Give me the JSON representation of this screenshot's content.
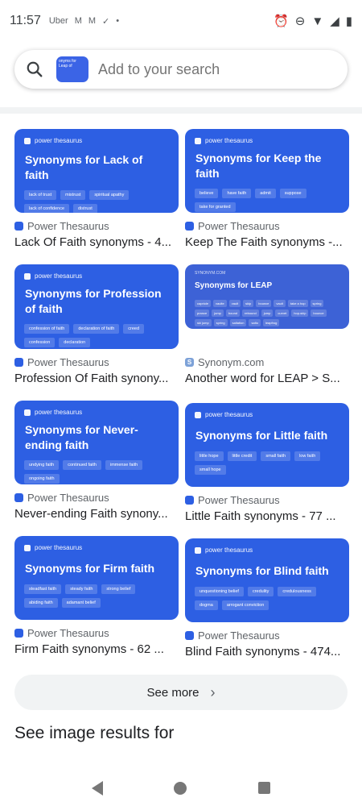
{
  "status": {
    "time": "11:57",
    "apps": [
      "Uber",
      "M",
      "M",
      "✓",
      "•"
    ]
  },
  "search": {
    "placeholder": "Add to your search",
    "thumb_text": "onyms for Leap of"
  },
  "results": [
    {
      "brand": "power thesaurus",
      "title": "Synonyms for Lack of faith",
      "chips": [
        "lack of trust",
        "mistrust",
        "spiritual apathy",
        "lack of confidence",
        "distrust"
      ],
      "source": "Power Thesaurus",
      "caption": "Lack Of Faith synonyms - 4..."
    },
    {
      "brand": "power thesaurus",
      "title": "Synonyms for Keep the faith",
      "chips": [
        "believe",
        "have faith",
        "admit",
        "suppose",
        "take for granted"
      ],
      "source": "Power Thesaurus",
      "caption": "Keep The Faith synonyms -..."
    },
    {
      "brand": "power thesaurus",
      "title": "Synonyms for Profession of faith",
      "chips": [
        "confession of faith",
        "declaration of faith",
        "creed",
        "confession",
        "declaration"
      ],
      "source": "Power Thesaurus",
      "caption": "Profession Of Faith synony..."
    },
    {
      "brand": "SYNONYM.COM",
      "title": "Synonyms for LEAP",
      "chips": [
        "capriole",
        "vaulte",
        "vault",
        "skip",
        "bounce",
        "vault",
        "take a hop",
        "spring",
        "prance",
        "jump",
        "bound",
        "rebound",
        "jump",
        "curvet",
        "hop-skip",
        "bounce",
        "ski jump",
        "spring",
        "saltation",
        "salto",
        "leapfrog"
      ],
      "source": "Synonym.com",
      "caption": "Another word for LEAP > S..."
    },
    {
      "brand": "power thesaurus",
      "title": "Synonyms for Never-ending faith",
      "chips": [
        "undying faith",
        "continued faith",
        "immense faith",
        "ongoing faith"
      ],
      "source": "Power Thesaurus",
      "caption": "Never-ending Faith synony..."
    },
    {
      "brand": "power thesaurus",
      "title": "Synonyms for Little faith",
      "chips": [
        "little hope",
        "little credit",
        "small faith",
        "low faith",
        "small hope"
      ],
      "source": "Power Thesaurus",
      "caption": "Little Faith synonyms - 77 ..."
    },
    {
      "brand": "power thesaurus",
      "title": "Synonyms for Firm faith",
      "chips": [
        "steadfast faith",
        "steady faith",
        "strong belief",
        "abiding faith",
        "adamant belief"
      ],
      "source": "Power Thesaurus",
      "caption": "Firm Faith synonyms - 62 ..."
    },
    {
      "brand": "power thesaurus",
      "title": "Synonyms for Blind faith",
      "chips": [
        "unquestioning belief",
        "credulity",
        "credulousness",
        "dogma",
        "arrogant conviction"
      ],
      "source": "Power Thesaurus",
      "caption": "Blind Faith synonyms - 474..."
    }
  ],
  "see_more": "See more",
  "see_image_results": "See image results for"
}
